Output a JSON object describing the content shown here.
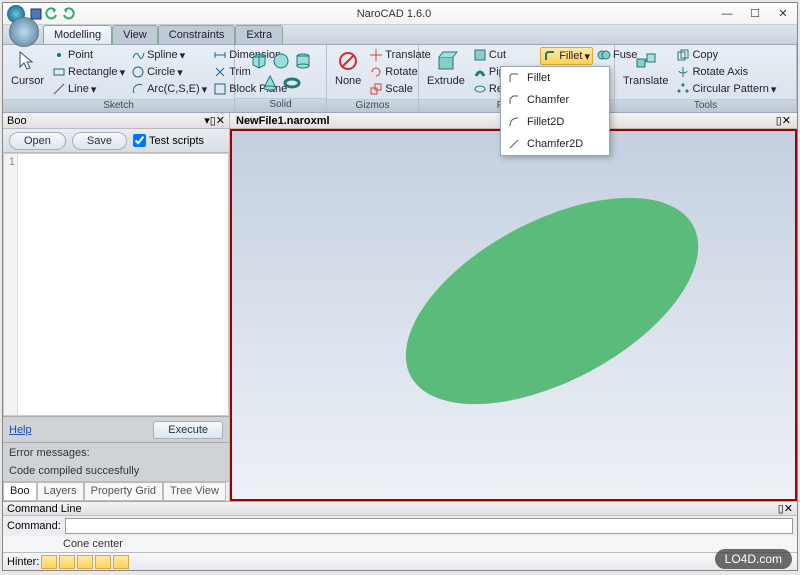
{
  "title": "NaroCAD 1.6.0",
  "tabs": [
    "Modelling",
    "View",
    "Constraints",
    "Extra"
  ],
  "active_tab": 0,
  "ribbon": {
    "sketch": {
      "label": "Sketch",
      "cursor": "Cursor",
      "items": [
        "Point",
        "Spline",
        "Dimension",
        "Rectangle",
        "Circle",
        "Trim",
        "Line",
        "Arc(C,S,E)",
        "Block Plane"
      ]
    },
    "solid": {
      "label": "Solid"
    },
    "gizmos": {
      "label": "Gizmos",
      "none": "None",
      "items": [
        "Translate",
        "Rotate",
        "Scale"
      ]
    },
    "features": {
      "label": "Features",
      "extrude": "Extrude",
      "col1": [
        "Cut",
        "Pipe",
        "Revolve"
      ],
      "fillet": "Fillet",
      "fuse": "Fuse"
    },
    "tools": {
      "label": "Tools",
      "translate": "Translate",
      "items": [
        "Copy",
        "Rotate Axis",
        "Circular Pattern"
      ]
    }
  },
  "fillet_menu": [
    "Fillet",
    "Chamfer",
    "Fillet2D",
    "Chamfer2D"
  ],
  "boo": {
    "title": "Boo",
    "open": "Open",
    "save": "Save",
    "test_scripts": "Test scripts",
    "line1": "1",
    "help": "Help",
    "execute": "Execute",
    "err_label": "Error messages:",
    "err_msg": "Code compiled succesfully"
  },
  "bottom_tabs": [
    "Boo",
    "Layers",
    "Property Grid",
    "Tree View"
  ],
  "document": "NewFile1.naroxml",
  "cmd": {
    "title": "Command Line",
    "label": "Command:",
    "history": "Cone center",
    "hinter": "Hinter:"
  },
  "watermark": "LO4D.com"
}
